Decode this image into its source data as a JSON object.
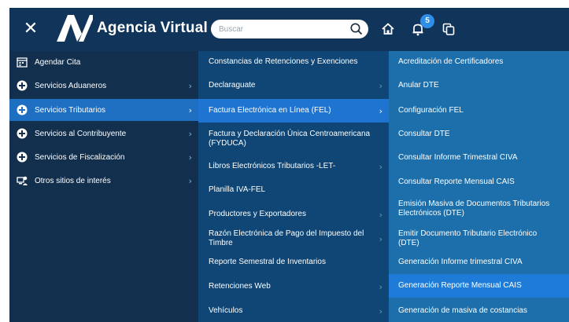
{
  "header": {
    "brand": "Agencia Virtual",
    "search_placeholder": "Buscar",
    "notification_count": "5",
    "icons": [
      "close-icon",
      "logo-icon",
      "search-icon",
      "home-icon",
      "bell-icon",
      "copy-icon"
    ]
  },
  "menu1": {
    "items": [
      {
        "label": "Agendar Cita",
        "icon": "calendar-icon"
      },
      {
        "label": "Servicios Aduaneros",
        "icon": "plus-circle-icon"
      },
      {
        "label": "Servicios Tributarios",
        "icon": "plus-circle-icon"
      },
      {
        "label": "Servicios al Contribuyente",
        "icon": "plus-circle-icon"
      },
      {
        "label": "Servicios de Fiscalización",
        "icon": "plus-circle-icon"
      },
      {
        "label": "Otros sitios de interés",
        "icon": "external-sites-icon"
      }
    ],
    "active_index": 2
  },
  "menu2": {
    "items": [
      {
        "label": "Constancias de Retenciones y Exenciones"
      },
      {
        "label": "Declaraguate"
      },
      {
        "label": "Factura Electrónica en Línea (FEL)"
      },
      {
        "label": "Factura y Declaración Única Centroamericana (FYDUCA)"
      },
      {
        "label": "Libros Electrónicos Tributarios -LET-"
      },
      {
        "label": "Planilla IVA-FEL"
      },
      {
        "label": "Productores y Exportadores"
      },
      {
        "label": "Razón Electrónica de Pago del Impuesto del Timbre"
      },
      {
        "label": "Reporte Semestral de Inventarios"
      },
      {
        "label": "Retenciones Web"
      },
      {
        "label": "Vehículos"
      }
    ],
    "active_index": 2
  },
  "menu3": {
    "items": [
      {
        "label": "Acreditación de Certificadores"
      },
      {
        "label": "Anular DTE"
      },
      {
        "label": "Configuración FEL"
      },
      {
        "label": "Consultar DTE"
      },
      {
        "label": "Consultar Informe Trimestral CIVA"
      },
      {
        "label": "Consultar Reporte Mensual CAIS"
      },
      {
        "label": "Emisión Masiva de Documentos Tributarios Electrónicos (DTE)"
      },
      {
        "label": "Emitir Documento Tributario Electrónico (DTE)"
      },
      {
        "label": "Generación Informe trimestral CIVA"
      },
      {
        "label": "Generación Reporte Mensual CAIS"
      },
      {
        "label": "Generación de masiva de costancias"
      }
    ],
    "active_index": 9
  },
  "colors": {
    "header_bg": "#11355a",
    "menu1_bg": "#12304e",
    "menu2_bg": "#0f4675",
    "menu3_bg": "#1c6fab",
    "active_bg": "#1e74d0",
    "badge_bg": "#2f8fe6"
  }
}
